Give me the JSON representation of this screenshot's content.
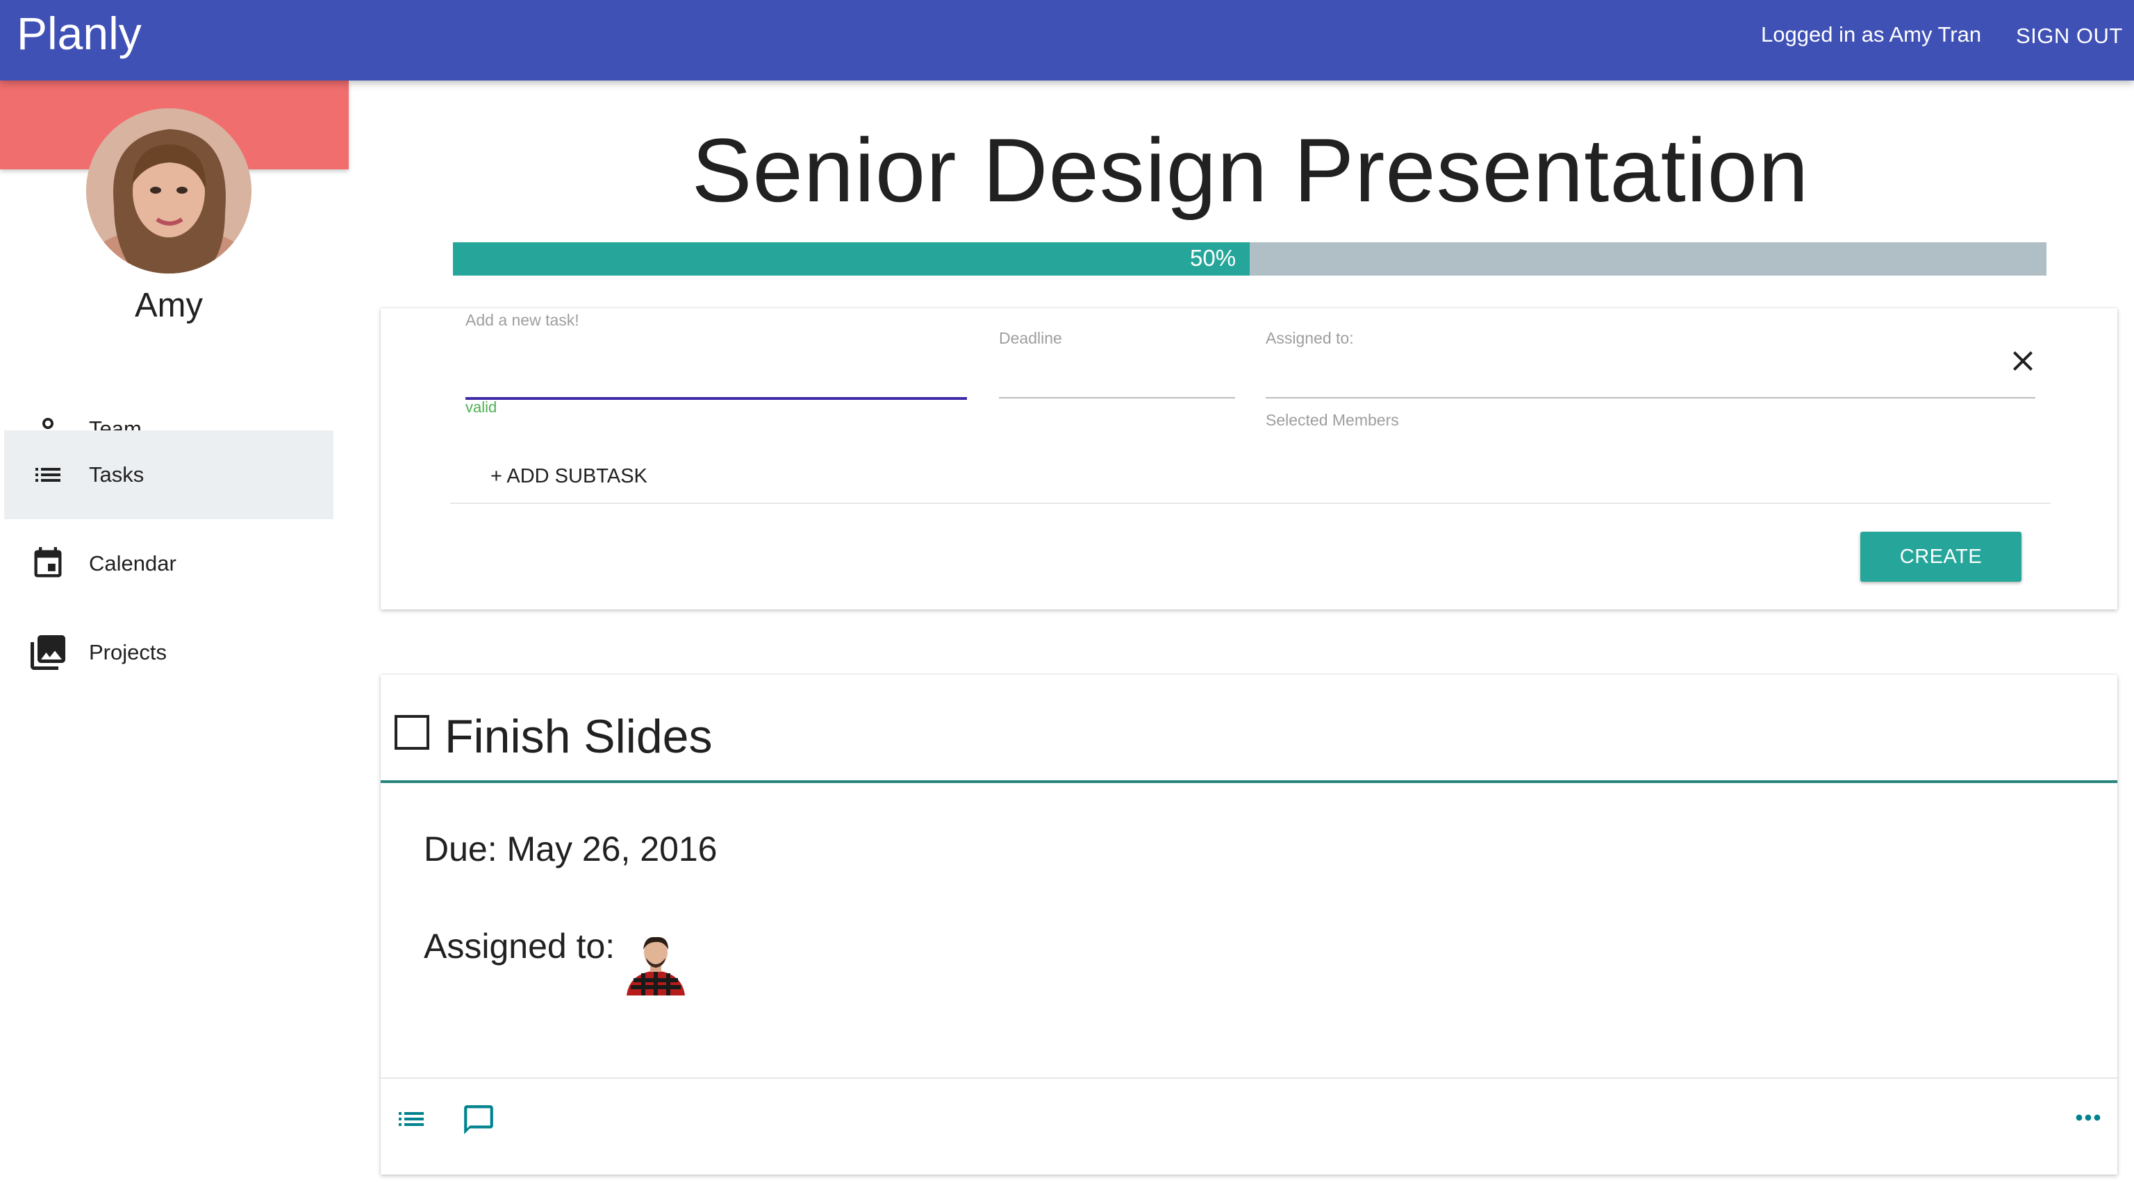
{
  "header": {
    "brand": "Planly",
    "logged_in_text": "Logged in as Amy Tran",
    "sign_out_label": "SIGN OUT",
    "background_color": "#3f51b5"
  },
  "sidebar": {
    "banner_color": "#f06e6e",
    "user_name": "Amy",
    "items": [
      {
        "label": "Team",
        "icon": "person-icon",
        "active": false
      },
      {
        "label": "Tasks",
        "icon": "list-icon",
        "active": true
      },
      {
        "label": "Calendar",
        "icon": "calendar-icon",
        "active": false
      },
      {
        "label": "Projects",
        "icon": "photo-library-icon",
        "active": false
      }
    ]
  },
  "project": {
    "title": "Senior Design Presentation",
    "progress_percent": 50,
    "progress_label": "50%",
    "progress_color": "#26a69a"
  },
  "new_task_form": {
    "task_label": "Add a new task!",
    "task_value": "",
    "task_status": "valid",
    "deadline_label": "Deadline",
    "deadline_value": "",
    "assigned_label": "Assigned to:",
    "assigned_value": "",
    "selected_members_label": "Selected Members",
    "add_subtask_label": "+ ADD SUBTASK",
    "create_label": "CREATE"
  },
  "task": {
    "title": "Finish Slides",
    "checked": false,
    "due_text": "Due: May 26, 2016",
    "assigned_label": "Assigned to:",
    "assignee_avatar": "avatar-icon"
  }
}
